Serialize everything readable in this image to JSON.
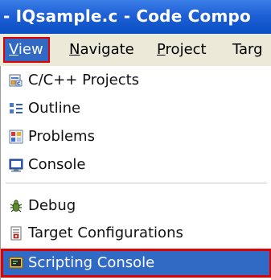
{
  "window": {
    "title": "- IQsample.c - Code Compo"
  },
  "menubar": {
    "view": {
      "label": "View",
      "mnemonic": "V",
      "rest": "iew"
    },
    "navigate": {
      "label": "Navigate",
      "mnemonic": "N",
      "rest": "avigate"
    },
    "project": {
      "label": "Project",
      "mnemonic": "P",
      "rest": "roject"
    },
    "target": {
      "label": "Targ"
    }
  },
  "dropdown": {
    "items": [
      {
        "label": "C/C++ Projects",
        "icon": "projects-icon"
      },
      {
        "label": "Outline",
        "icon": "outline-icon"
      },
      {
        "label": "Problems",
        "icon": "problems-icon"
      },
      {
        "label": "Console",
        "icon": "console-icon"
      },
      {
        "label": "Debug",
        "icon": "debug-icon"
      },
      {
        "label": "Target Configurations",
        "icon": "target-config-icon"
      },
      {
        "label": "Scripting Console",
        "icon": "scripting-console-icon",
        "selected": true
      }
    ]
  },
  "colors": {
    "titlebar": "#0b4fc4",
    "menubar_bg": "#ece9d8",
    "selection": "#316ac5",
    "highlight_outline": "#e00000"
  }
}
